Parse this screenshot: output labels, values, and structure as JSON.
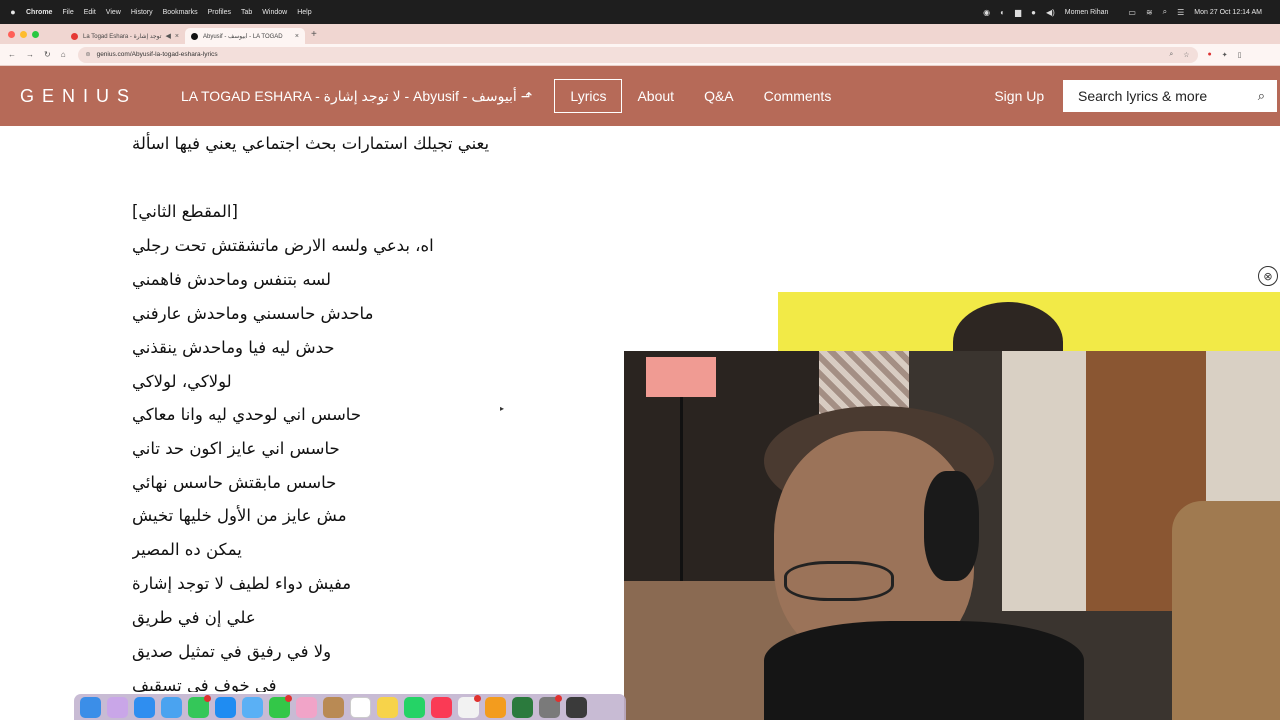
{
  "menubar": {
    "app": "Chrome",
    "items": [
      "File",
      "Edit",
      "View",
      "History",
      "Bookmarks",
      "Profiles",
      "Tab",
      "Window",
      "Help"
    ],
    "user": "Momen Rihan",
    "datetime": "Mon 27 Oct  12:14 AM"
  },
  "tabs": [
    {
      "title": "La Togad Eshara - أبيوسف - لا توجد إشارة",
      "favicon_color": "#e53935"
    },
    {
      "title": "Abyusif - أبيوسف - LA TOGAD",
      "favicon_color": "#111111"
    }
  ],
  "addressbar": {
    "url": "genius.com/Abyusif-la-togad-eshara-lyrics"
  },
  "genius": {
    "logo": "GENIUS",
    "song_title": "LA TOGAD ESHARA - لا توجد إشارة - Abyusif - أبيوسف ⬏",
    "nav": [
      "Lyrics",
      "About",
      "Q&A",
      "Comments"
    ],
    "active_nav": "Lyrics",
    "signup": "Sign Up",
    "search_placeholder": "Search lyrics & more"
  },
  "lyrics": [
    "يعني تجيلك استمارات بحث اجتماعي يعني فيها اسألة",
    "",
    "[المقطع الثاني]",
    "اه، بدعي ولسه الارض ماتشقتش تحت رجلي",
    "لسه بتنفس وماحدش فاهمني",
    "ماحدش حاسسني وماحدش عارفني",
    "حدش ليه فيا وماحدش ينقذني",
    "لولاكي، لولاكي",
    "حاسس اني لوحدي ليه وانا معاكي",
    "حاسس اني عايز اكون حد تاني",
    "حاسس مابقتش حاسس نهائي",
    "مش عايز من الأول خليها تخيش",
    "يمكن ده المصير",
    "مفيش دواء لطيف لا توجد إشارة",
    "علي إن في طريق",
    "ولا في رفيق في تمثيل صديق",
    "في خوف في تسقيف"
  ],
  "video": {
    "close_symbol": "⊗"
  },
  "dock": {
    "badge_color": "#e0312f"
  }
}
